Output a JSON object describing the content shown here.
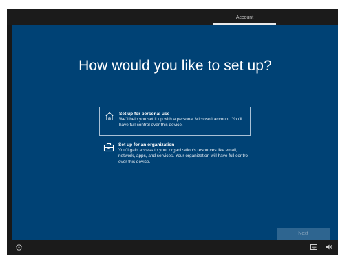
{
  "topbar": {
    "tab_label": "Account"
  },
  "main": {
    "heading": "How would you like to set up?",
    "options": [
      {
        "icon": "home-icon",
        "title": "Set up for personal use",
        "description": "We'll help you set it up with a personal Microsoft account. You'll have full control over this device.",
        "selected": true
      },
      {
        "icon": "briefcase-icon",
        "title": "Set up for an organization",
        "description": "You'll gain access to your organization's resources like email, network, apps, and services. Your organization will have full control over this device.",
        "selected": false
      }
    ],
    "next_label": "Next"
  },
  "bottombar": {
    "icons": [
      "ease-of-access-icon",
      "keyboard-icon",
      "volume-icon"
    ]
  },
  "colors": {
    "background": "#004275",
    "chrome": "#1b1b1b",
    "next_button": "#2e6590"
  }
}
